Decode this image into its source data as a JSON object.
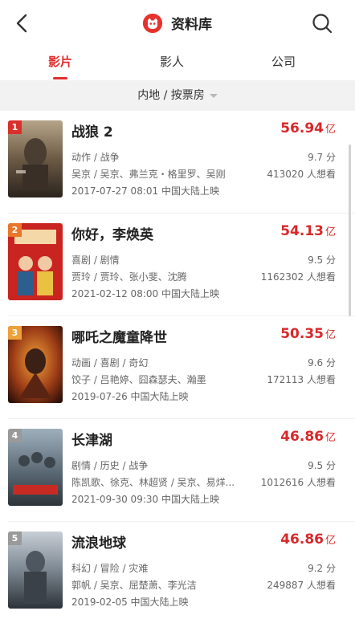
{
  "header": {
    "title": "资料库",
    "back_icon": "chevron-left-icon",
    "search_icon": "search-icon",
    "brand_color": "#e8322e"
  },
  "tabs": [
    {
      "label": "影片",
      "active": true
    },
    {
      "label": "影人",
      "active": false
    },
    {
      "label": "公司",
      "active": false
    }
  ],
  "filter": {
    "label": "内地 / 按票房"
  },
  "movies": [
    {
      "rank": "1",
      "title": "战狼 2",
      "box_value": "56.94",
      "box_unit": "亿",
      "genres": "动作 / 战争",
      "score": "9.7 分",
      "cast": "吴京 / 吴京、弗兰克・格里罗、吴刚",
      "want": "413020 人想看",
      "release": "2017-07-27 08:01 中国大陆上映",
      "badge_color": "#d9302c"
    },
    {
      "rank": "2",
      "title": "你好，李焕英",
      "box_value": "54.13",
      "box_unit": "亿",
      "genres": "喜剧 / 剧情",
      "score": "9.5 分",
      "cast": "贾玲 / 贾玲、张小斐、沈腾",
      "want": "1162302 人想看",
      "release": "2021-02-12 08:00 中国大陆上映",
      "badge_color": "#e9762b"
    },
    {
      "rank": "3",
      "title": "哪吒之魔童降世",
      "box_value": "50.35",
      "box_unit": "亿",
      "genres": "动画 / 喜剧 / 奇幻",
      "score": "9.6 分",
      "cast": "饺子 / 吕艳婷、囧森瑟夫、瀚墨",
      "want": "172113 人想看",
      "release": "2019-07-26 中国大陆上映",
      "badge_color": "#eea13a"
    },
    {
      "rank": "4",
      "title": "长津湖",
      "box_value": "46.86",
      "box_unit": "亿",
      "genres": "剧情 / 历史 / 战争",
      "score": "9.5 分",
      "cast": "陈凯歌、徐克、林超贤 / 吴京、易烊...",
      "want": "1012616 人想看",
      "release": "2021-09-30 09:30 中国大陆上映",
      "badge_color": "#9a9a9a"
    },
    {
      "rank": "5",
      "title": "流浪地球",
      "box_value": "46.86",
      "box_unit": "亿",
      "genres": "科幻 / 冒险 / 灾难",
      "score": "9.2 分",
      "cast": "郭帆 / 吴京、屈楚萧、李光洁",
      "want": "249887 人想看",
      "release": "2019-02-05 中国大陆上映",
      "badge_color": "#9a9a9a"
    }
  ]
}
